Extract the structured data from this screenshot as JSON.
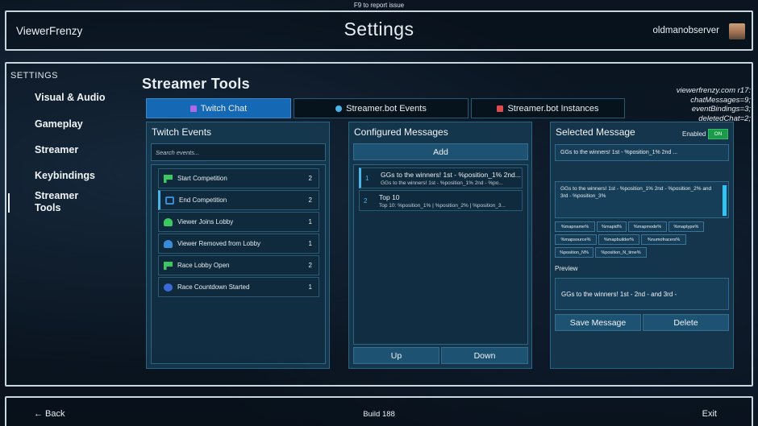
{
  "report_hint": "F9 to report issue",
  "header": {
    "app_title": "ViewerFrenzy",
    "page_title": "Settings",
    "username": "oldmanobserver"
  },
  "sidebar": {
    "heading": "SETTINGS",
    "items": [
      {
        "label": "Visual & Audio"
      },
      {
        "label": "Gameplay"
      },
      {
        "label": "Streamer"
      },
      {
        "label": "Keybindings"
      },
      {
        "label": "Streamer Tools"
      }
    ],
    "active_index": 4
  },
  "section_title": "Streamer Tools",
  "debug": {
    "lines": [
      "viewerfrenzy.com r17:",
      "chatMessages=9;",
      "eventBindings=3;",
      "deletedChat=2;"
    ]
  },
  "tabs": [
    {
      "label": "Twitch Chat",
      "icon": "twitch-icon",
      "active": true
    },
    {
      "label": "Streamer.bot Events",
      "icon": "streamerbot-icon",
      "active": false
    },
    {
      "label": "Streamer.bot Instances",
      "icon": "cube-icon",
      "active": false
    }
  ],
  "events_panel": {
    "title": "Twitch Events",
    "search_placeholder": "Search events...",
    "events": [
      {
        "label": "Start Competition",
        "count": "2",
        "icon": "flag-icon",
        "icon_color": "#3cc860"
      },
      {
        "label": "End Competition",
        "count": "2",
        "icon": "finish-flag-icon",
        "icon_color": "#3a8ad8"
      },
      {
        "label": "Viewer Joins Lobby",
        "count": "1",
        "icon": "user-join-icon",
        "icon_color": "#3cc860"
      },
      {
        "label": "Viewer Removed from Lobby",
        "count": "1",
        "icon": "user-remove-icon",
        "icon_color": "#3a8ad8"
      },
      {
        "label": "Race Lobby Open",
        "count": "2",
        "icon": "flag-icon",
        "icon_color": "#3cc860"
      },
      {
        "label": "Race Countdown Started",
        "count": "1",
        "icon": "timer-icon",
        "icon_color": "#3a6ad8"
      }
    ],
    "selected_index": 1
  },
  "messages_panel": {
    "title": "Configured Messages",
    "add_label": "Add",
    "up_label": "Up",
    "down_label": "Down",
    "messages": [
      {
        "num": "1",
        "title": "GGs to the winners!   1st - %position_1% 2nd...",
        "preview": "GGs to the winners!   1st - %position_1% 2nd - %po..."
      },
      {
        "num": "2",
        "title": "Top 10",
        "preview": "Top 10: %position_1% | %position_2% | %position_3..."
      }
    ],
    "selected_index": 0
  },
  "selected_panel": {
    "title": "Selected Message",
    "enabled_label": "Enabled",
    "toggle_label": "ON",
    "name_value": "GGs to the winners!   1st - %position_1% 2nd ...",
    "body_value": "GGs to the winners!   1st - %position_1% 2nd - %position_2% and 3rd - %position_3%",
    "tokens": [
      "%mapname%",
      "%mapid%",
      "%mapmode%",
      "%maptype%",
      "%mapsource%",
      "%mapbuilder%",
      "%numofracers%",
      "%position_N%",
      "%position_N_time%"
    ],
    "preview_label": "Preview",
    "preview_value": "GGs to the winners! 1st - 2nd - and 3rd -",
    "save_label": "Save Message",
    "delete_label": "Delete"
  },
  "footer": {
    "back_label": "← Back",
    "build_label": "Build 188",
    "exit_label": "Exit"
  }
}
